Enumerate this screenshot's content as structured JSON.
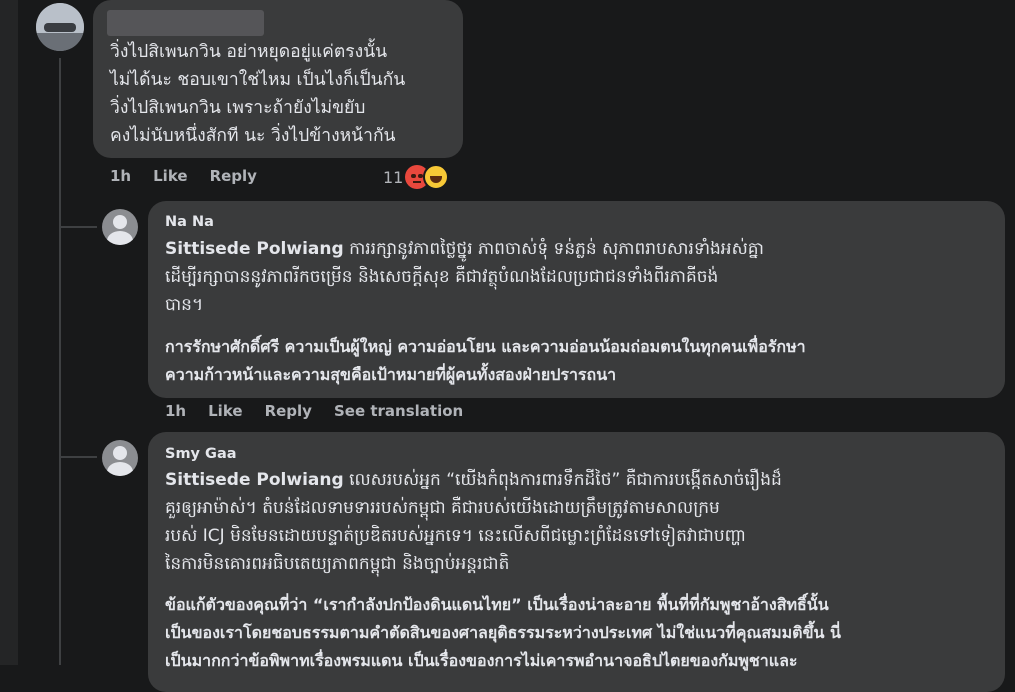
{
  "comment1": {
    "author": "",
    "lines": [
      "วิ่งไปสิเพนกวิน อย่าหยุดอยู่แค่ตรงนั้น",
      "ไม่ได้นะ ชอบเขาใช่ไหม เป็นไงก็เป็นกัน",
      "วิ่งไปสิเพนกวิน เพราะถ้ายังไม่ขยับ",
      "คงไม่นับหนึ่งสักที นะ วิ่งไปข้างหน้ากัน"
    ],
    "time": "1h",
    "like": "Like",
    "reply": "Reply",
    "reaction_count": "11",
    "reactions": [
      "angry-emoji",
      "haha-emoji"
    ]
  },
  "comment2": {
    "author": "Na Na",
    "tag": "Sittisede Polwiang",
    "khmer_lines": [
      "ការរក្សានូវភាពថ្លៃថ្នូរ ភាពចាស់ទុំ ទន់ភ្លន់ សុភាពរាបសារទាំងអស់គ្នា",
      "ដើម្បីរក្សាបាននូវភាពរីកចម្រើន និងសេចក្តីសុខ គឺជាវត្ថុបំណងដែលប្រជាជនទាំងពីរភាគីចង់",
      "បាន។"
    ],
    "thai_lines": [
      "การรักษาศักดิ์ศรี ความเป็นผู้ใหญ่ ความอ่อนโยน และความอ่อนน้อมถ่อมตนในทุกคนเพื่อรักษา",
      "ความก้าวหน้าและความสุขคือเป้าหมายที่ผู้คนทั้งสองฝ่ายปรารถนา"
    ],
    "time": "1h",
    "like": "Like",
    "reply": "Reply",
    "see_translation": "See translation"
  },
  "comment3": {
    "author": "Smy Gaa",
    "tag": "Sittisede Polwiang",
    "khmer_lines": [
      "លេសរបស់អ្នក “យើងកំពុងការពារទឹកដីថៃ” គឺជាការបង្កើតសាច់រឿងដ៏",
      "គួរឲ្យអាម៉ាស់។ តំបន់ដែលទាមទាររបស់កម្ពុជា គឺជារបស់យើងដោយត្រឹមត្រូវតាមសាលក្រម",
      "របស់ ICJ មិនមែនដោយបន្ទាត់ប្រឌិតរបស់អ្នកទេ។ នេះលើសពីជម្លោះព្រំដែនទៅទៀតវាជាបញ្ហា",
      "នៃការមិនគោរពអធិបតេយ្យភាពកម្ពុជា និងច្បាប់អន្តរជាតិ"
    ],
    "thai_lines": [
      "ข้อแก้ตัวของคุณที่ว่า “เรากำลังปกป้องดินแดนไทย” เป็นเรื่องน่าละอาย พื้นที่ที่กัมพูชาอ้างสิทธิ์นั้น",
      "เป็นของเราโดยชอบธรรมตามคำตัดสินของศาลยุติธรรมระหว่างประเทศ ไม่ใช่แนวที่คุณสมมติขึ้น นี่",
      "เป็นมากกว่าข้อพิพาทเรื่องพรมแดน เป็นเรื่องของการไม่เคารพอำนาจอธิปไตยของกัมพูชาและ"
    ]
  },
  "colors": {
    "background": "#18191a",
    "bubble": "#3a3b3c",
    "text": "#e4e6eb",
    "meta": "#b0b3b8"
  }
}
